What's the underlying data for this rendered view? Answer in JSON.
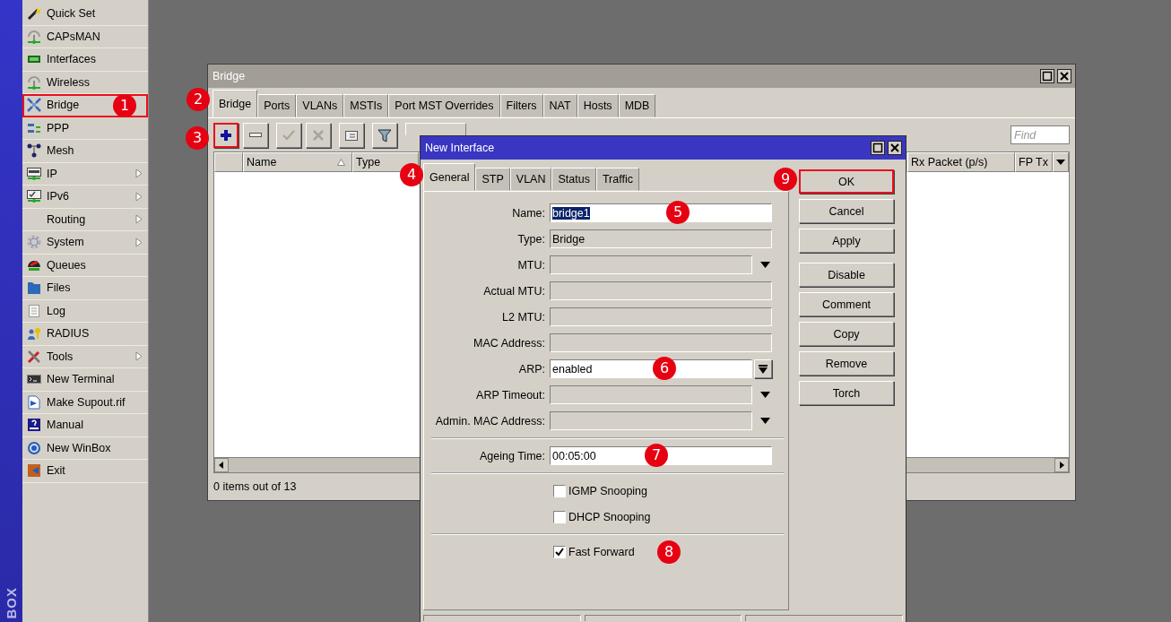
{
  "sidebar": {
    "brand": "BOX",
    "items": [
      {
        "label": "Quick Set",
        "kind": "wand",
        "submenu": false,
        "highlighted": false
      },
      {
        "label": "CAPsMAN",
        "kind": "antenna",
        "submenu": false,
        "highlighted": false
      },
      {
        "label": "Interfaces",
        "kind": "card",
        "submenu": false,
        "highlighted": false
      },
      {
        "label": "Wireless",
        "kind": "antenna",
        "submenu": false,
        "highlighted": false
      },
      {
        "label": "Bridge",
        "kind": "bridge",
        "submenu": false,
        "highlighted": true,
        "marker": "1"
      },
      {
        "label": "PPP",
        "kind": "ppp",
        "submenu": false,
        "highlighted": false
      },
      {
        "label": "Mesh",
        "kind": "mesh",
        "submenu": false,
        "highlighted": false
      },
      {
        "label": "IP",
        "kind": "ip",
        "submenu": true,
        "highlighted": false
      },
      {
        "label": "IPv6",
        "kind": "ipv6",
        "submenu": true,
        "highlighted": false
      },
      {
        "label": "Routing",
        "kind": "plain",
        "submenu": true,
        "highlighted": false
      },
      {
        "label": "System",
        "kind": "gear",
        "submenu": true,
        "highlighted": false
      },
      {
        "label": "Queues",
        "kind": "queue",
        "submenu": false,
        "highlighted": false
      },
      {
        "label": "Files",
        "kind": "folder",
        "submenu": false,
        "highlighted": false
      },
      {
        "label": "Log",
        "kind": "doc",
        "submenu": false,
        "highlighted": false
      },
      {
        "label": "RADIUS",
        "kind": "radius",
        "submenu": false,
        "highlighted": false
      },
      {
        "label": "Tools",
        "kind": "tools",
        "submenu": true,
        "highlighted": false
      },
      {
        "label": "New Terminal",
        "kind": "terminal",
        "submenu": false,
        "highlighted": false
      },
      {
        "label": "Make Supout.rif",
        "kind": "supout",
        "submenu": false,
        "highlighted": false
      },
      {
        "label": "Manual",
        "kind": "manual",
        "submenu": false,
        "highlighted": false
      },
      {
        "label": "New WinBox",
        "kind": "winbox",
        "submenu": false,
        "highlighted": false
      },
      {
        "label": "Exit",
        "kind": "exit",
        "submenu": false,
        "highlighted": false
      }
    ]
  },
  "bridge_window": {
    "title": "Bridge",
    "tabs_marker": "2",
    "tabs": [
      {
        "label": "Bridge",
        "selected": true
      },
      {
        "label": "Ports",
        "selected": false
      },
      {
        "label": "VLANs",
        "selected": false
      },
      {
        "label": "MSTIs",
        "selected": false
      },
      {
        "label": "Port MST Overrides",
        "selected": false
      },
      {
        "label": "Filters",
        "selected": false
      },
      {
        "label": "NAT",
        "selected": false
      },
      {
        "label": "Hosts",
        "selected": false
      },
      {
        "label": "MDB",
        "selected": false
      }
    ],
    "toolbar": [
      {
        "kind": "add",
        "disabled": false,
        "highlighted": true,
        "marker": "3"
      },
      {
        "kind": "remove",
        "disabled": false,
        "highlighted": false
      },
      {
        "kind": "enable",
        "disabled": true,
        "highlighted": false
      },
      {
        "kind": "disable",
        "disabled": true,
        "highlighted": false
      },
      {
        "kind": "comment",
        "disabled": false,
        "highlighted": false
      },
      {
        "kind": "filter",
        "disabled": false,
        "highlighted": false
      },
      {
        "kind": "settings"
      }
    ],
    "find": {
      "placeholder": "Find"
    },
    "columns": [
      {
        "label": "Name",
        "sorted": true
      },
      {
        "label": "Type",
        "sorted": false
      },
      {
        "label": "Rx Packet (p/s)",
        "sorted": false
      },
      {
        "label": "FP Tx",
        "sorted": false
      }
    ],
    "status": "0 items out of 13"
  },
  "dialog": {
    "title": "New Interface",
    "tabs_marker": "4",
    "tabs": [
      {
        "label": "General",
        "selected": true
      },
      {
        "label": "STP",
        "selected": false
      },
      {
        "label": "VLAN",
        "selected": false
      },
      {
        "label": "Status",
        "selected": false
      },
      {
        "label": "Traffic",
        "selected": false
      }
    ],
    "fields": [
      {
        "kind": "text",
        "label": "Name:",
        "value": "bridge1",
        "value_selected": true,
        "marker": "5"
      },
      {
        "kind": "readonly",
        "label": "Type:",
        "value": "Bridge"
      },
      {
        "kind": "dropdown",
        "label": "MTU:"
      },
      {
        "kind": "readonly",
        "label": "Actual MTU:"
      },
      {
        "kind": "readonly",
        "label": "L2 MTU:"
      },
      {
        "kind": "readonly",
        "label": "MAC Address:"
      },
      {
        "kind": "select",
        "label": "ARP:",
        "value": "enabled",
        "marker": "6"
      },
      {
        "kind": "dropdown",
        "label": "ARP Timeout:"
      },
      {
        "kind": "dropdown",
        "label": "Admin. MAC Address:"
      },
      {
        "kind": "separator"
      },
      {
        "kind": "text",
        "label": "Ageing Time:",
        "value": "00:05:00",
        "value_selected": false,
        "marker": "7"
      },
      {
        "kind": "separator"
      },
      {
        "kind": "checkbox",
        "label": "IGMP Snooping",
        "checked": false
      },
      {
        "kind": "checkbox",
        "label": "DHCP Snooping",
        "checked": false
      },
      {
        "kind": "separator"
      },
      {
        "kind": "checkbox",
        "label": "Fast Forward",
        "checked": true,
        "marker": "8"
      }
    ],
    "buttons": [
      {
        "label": "OK",
        "highlighted": true,
        "marker": "9"
      },
      {
        "label": "Cancel",
        "highlighted": false
      },
      {
        "label": "Apply",
        "highlighted": false
      },
      {
        "label": "Disable",
        "highlighted": false
      },
      {
        "label": "Comment",
        "highlighted": false
      },
      {
        "label": "Copy",
        "highlighted": false
      },
      {
        "label": "Remove",
        "highlighted": false
      },
      {
        "label": "Torch",
        "highlighted": false
      }
    ]
  }
}
